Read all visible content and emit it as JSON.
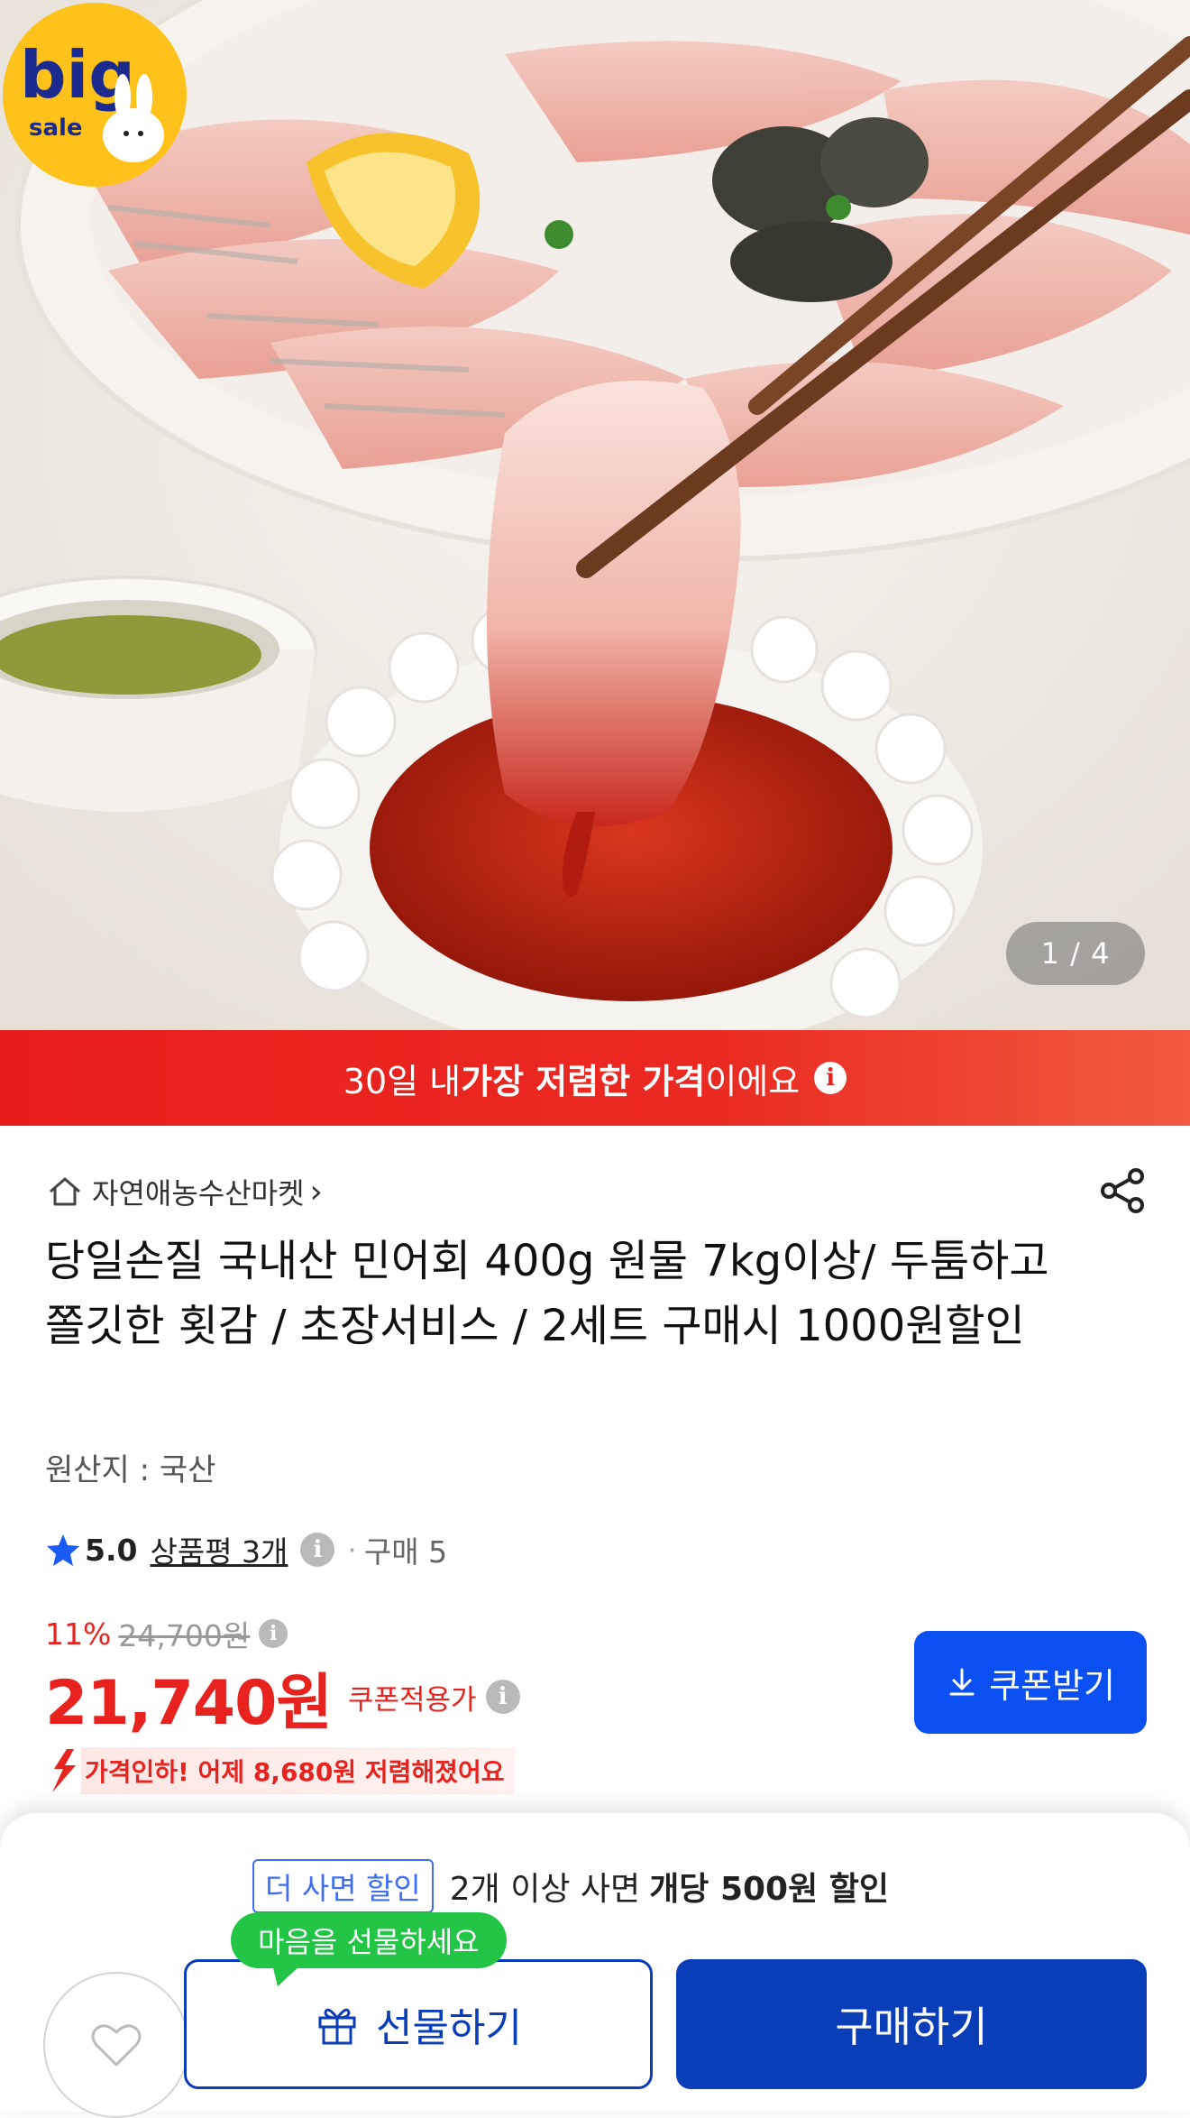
{
  "hero": {
    "counter": "1 / 4",
    "badge_big": "big",
    "badge_sale": "sale"
  },
  "banner": {
    "prefix": "30일 내 ",
    "highlight": "가장 저렴한 가격",
    "suffix": "이에요",
    "info_icon": "i"
  },
  "store": {
    "name": "자연애농수산마켓",
    "chevron": "›"
  },
  "product": {
    "title": "당일손질 국내산 민어회 400g 원물 7kg이상/ 두툼하고 쫄깃한 횟감 / 초장서비스 / 2세트 구매시 1000원할인",
    "origin": "원산지 : 국산"
  },
  "rating": {
    "score": "5.0",
    "review_label": "상품평 3개",
    "info_icon": "i",
    "separator": "·",
    "sales": "구매 5"
  },
  "price": {
    "discount_pct": "11%",
    "original_price": "24,700원",
    "info_icon": "i",
    "final_price": "21,740원",
    "coupon_label": "쿠폰적용가",
    "coupon_button": "쿠폰받기",
    "drop_note": "가격인하! 어제 8,680원 저렴해졌어요"
  },
  "bottom_sheet": {
    "bulk_tag": "더 사면 할인",
    "bulk_text": "2개 이상 사면",
    "bulk_bold": "개당 500원 할인",
    "gift_tooltip": "마음을 선물하세요",
    "gift_button": "선물하기",
    "buy_button": "구매하기"
  },
  "colors": {
    "accent_red": "#e8231f",
    "accent_blue": "#0a4ff2",
    "buy_blue": "#0a3eb8",
    "tooltip_green": "#22c545"
  },
  "icons": [
    "home-icon",
    "share-icon",
    "star-icon",
    "info-icon",
    "download-icon",
    "price-down-arrow-icon",
    "heart-icon",
    "gift-icon"
  ]
}
